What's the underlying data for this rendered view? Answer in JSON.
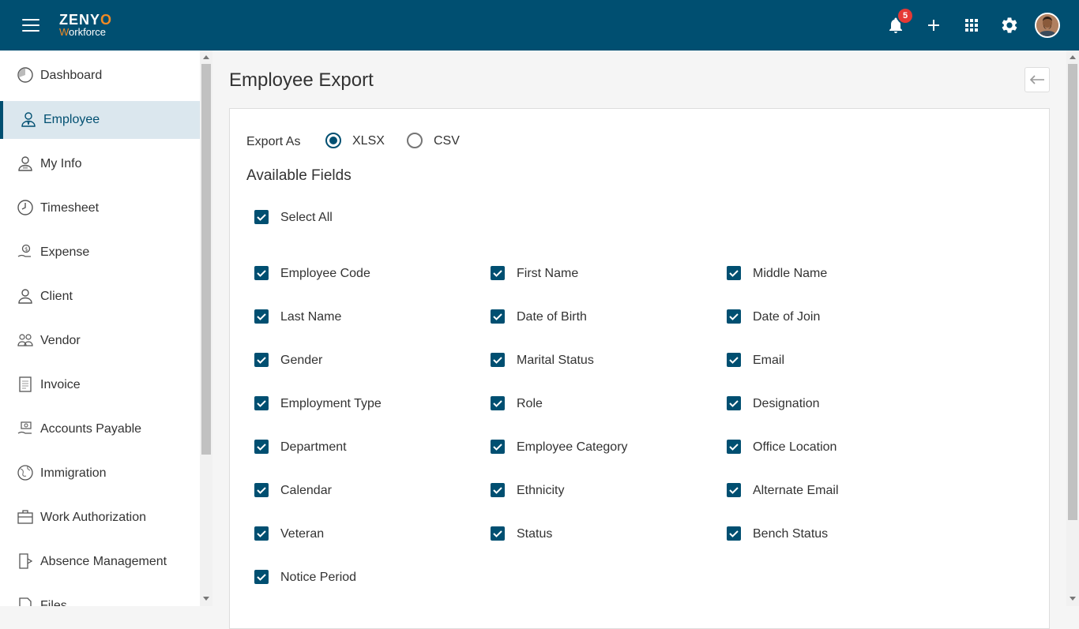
{
  "header": {
    "logo_line1_a": "ZENY",
    "logo_line1_b": "O",
    "logo_line2_a": "W",
    "logo_line2_b": "orkforce",
    "notification_count": "5",
    "icons": [
      "menu-icon",
      "bell-icon",
      "plus-icon",
      "apps-grid-icon",
      "gear-icon",
      "avatar"
    ],
    "brand_color": "#004f71",
    "accent_color": "#f08a24"
  },
  "sidebar": {
    "items": [
      {
        "label": "Dashboard",
        "icon": "dashboard-icon"
      },
      {
        "label": "Employee",
        "icon": "employee-icon",
        "active": true
      },
      {
        "label": "My Info",
        "icon": "my-info-icon"
      },
      {
        "label": "Timesheet",
        "icon": "clock-icon"
      },
      {
        "label": "Expense",
        "icon": "expense-icon"
      },
      {
        "label": "Client",
        "icon": "client-icon"
      },
      {
        "label": "Vendor",
        "icon": "vendor-icon"
      },
      {
        "label": "Invoice",
        "icon": "invoice-icon"
      },
      {
        "label": "Accounts Payable",
        "icon": "accounts-payable-icon"
      },
      {
        "label": "Immigration",
        "icon": "globe-icon"
      },
      {
        "label": "Work Authorization",
        "icon": "briefcase-icon"
      },
      {
        "label": "Absence Management",
        "icon": "door-icon"
      },
      {
        "label": "Files",
        "icon": "file-icon"
      }
    ]
  },
  "main": {
    "title": "Employee Export",
    "export_as_label": "Export As",
    "formats": [
      {
        "label": "XLSX",
        "selected": true
      },
      {
        "label": "CSV",
        "selected": false
      }
    ],
    "available_fields_label": "Available Fields",
    "select_all_label": "Select All",
    "fields": [
      [
        "Employee Code",
        "First Name",
        "Middle Name"
      ],
      [
        "Last Name",
        "Date of Birth",
        "Date of Join"
      ],
      [
        "Gender",
        "Marital Status",
        "Email"
      ],
      [
        "Employment Type",
        "Role",
        "Designation"
      ],
      [
        "Department",
        "Employee Category",
        "Office Location"
      ],
      [
        "Calendar",
        "Ethnicity",
        "Alternate Email"
      ],
      [
        "Veteran",
        "Status",
        "Bench Status"
      ],
      [
        "Notice Period"
      ]
    ]
  }
}
